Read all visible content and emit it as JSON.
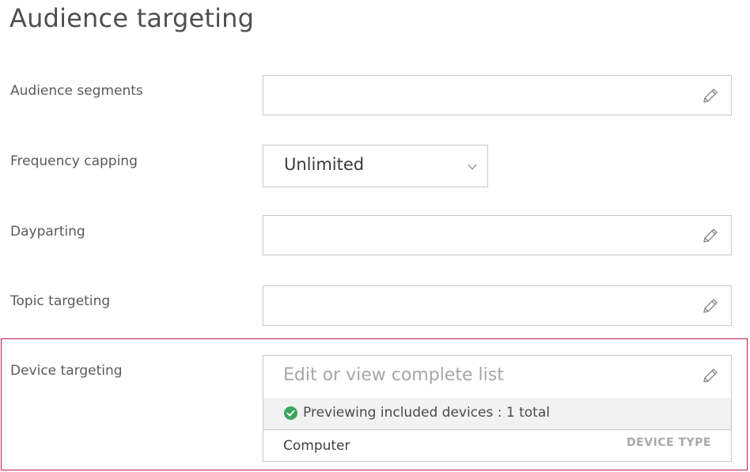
{
  "page": {
    "title": "Audience targeting"
  },
  "fields": {
    "audience_segments": {
      "label": "Audience segments",
      "icon": "pencil-icon"
    },
    "frequency_capping": {
      "label": "Frequency capping",
      "value": "Unlimited",
      "icon": "chevron-down-icon"
    },
    "dayparting": {
      "label": "Dayparting",
      "icon": "pencil-icon"
    },
    "topic_targeting": {
      "label": "Topic targeting",
      "icon": "pencil-icon"
    },
    "device_targeting": {
      "label": "Device targeting",
      "placeholder": "Edit or view complete list",
      "icon": "pencil-icon",
      "preview_text": "Previewing included devices : 1 total",
      "devices": [
        {
          "name": "Computer",
          "type_label": "DEVICE TYPE"
        }
      ]
    }
  },
  "colors": {
    "highlight_border": "#c2185b",
    "check_green": "#3aa55d",
    "field_border": "#c9c9c9"
  }
}
